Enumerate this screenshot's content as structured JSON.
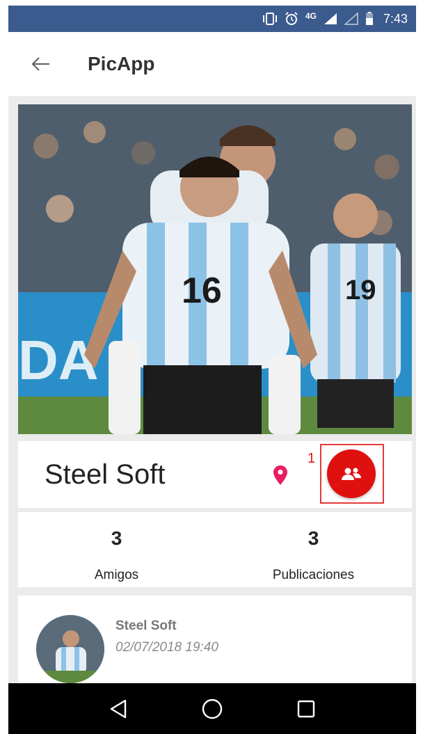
{
  "status_bar": {
    "network": "4G",
    "time": "7:43",
    "icons": [
      "vibrate-icon",
      "alarm-icon",
      "signal-icon",
      "signal-empty-icon",
      "battery-icon"
    ],
    "background": "#3b5a8d"
  },
  "app_bar": {
    "title": "PicApp",
    "back_icon": "arrow-back-icon"
  },
  "profile": {
    "name": "Steel Soft",
    "location_icon": "location-pin-icon",
    "location_color": "#e91e63",
    "friend_request_count": "1",
    "friends_button_icon": "people-icon",
    "accent": "#e01010"
  },
  "stats": {
    "friends": {
      "value": "3",
      "label": "Amigos"
    },
    "posts": {
      "value": "3",
      "label": "Publicaciones"
    }
  },
  "post": {
    "author": "Steel Soft",
    "date": "02/07/2018 19:40"
  },
  "nav_bar": {
    "buttons": [
      "back-triangle-icon",
      "home-circle-icon",
      "recents-square-icon"
    ]
  }
}
